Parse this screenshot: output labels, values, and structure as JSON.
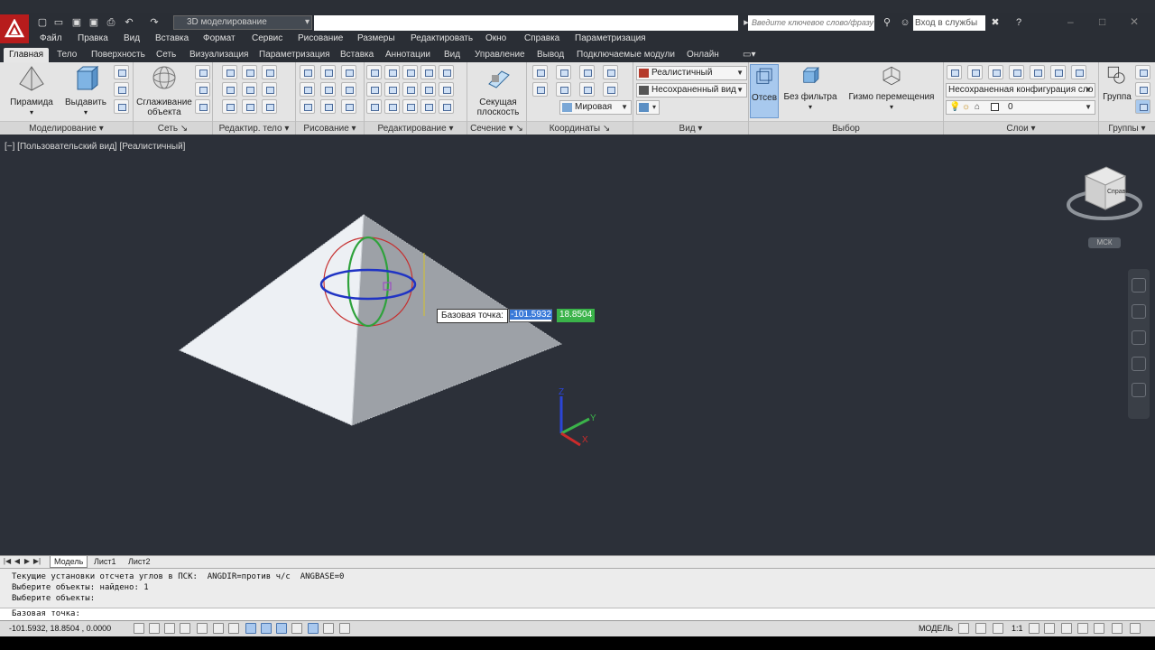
{
  "app": {
    "workspace": "3D моделирование",
    "search_placeholder": "Введите ключевое слово/фразу",
    "signin": "Вход в службы"
  },
  "menu": [
    "Файл",
    "Правка",
    "Вид",
    "Вставка",
    "Формат",
    "Сервис",
    "Рисование",
    "Размеры",
    "Редактировать",
    "Окно",
    "Справка",
    "Параметризация"
  ],
  "ribbon_tabs": [
    "Главная",
    "Тело",
    "Поверхность",
    "Сеть",
    "Визуализация",
    "Параметризация",
    "Вставка",
    "Аннотации",
    "Вид",
    "Управление",
    "Вывод",
    "Подключаемые модули",
    "Онлайн"
  ],
  "ribbon": {
    "pyramid": "Пирамида",
    "extrude": "Выдавить",
    "smooth_line1": "Сглаживание",
    "smooth_line2": "объекта",
    "section_line1": "Секущая",
    "section_line2": "плоскость",
    "visual_style": "Реалистичный",
    "saved_view": "Несохраненный вид",
    "ucs_world": "Мировая",
    "cull": "Отсев",
    "no_filter": "Без фильтра",
    "gizmo": "Гизмо перемещения",
    "layer_config": "Несохраненная конфигурация сло",
    "layer_current": "0",
    "group": "Группа",
    "panels": {
      "modeling": "Моделирование",
      "mesh": "Сеть",
      "solid_edit": "Редактир. тело",
      "draw": "Рисование",
      "modify": "Редактирование",
      "section": "Сечение",
      "coordinates": "Координаты",
      "view": "Вид",
      "selection": "Выбор",
      "layers": "Слои",
      "groups": "Группы"
    }
  },
  "viewport": {
    "label": "[−] [Пользовательский вид] [Реалистичный]",
    "dyn_prompt": "Базовая точка:",
    "dyn_x": "-101.5932",
    "dyn_y": "18.8504",
    "viewcube_label": "Справа",
    "ucs_badge": "МСК",
    "axis_x": "X",
    "axis_y": "Y",
    "axis_z": "Z"
  },
  "layout_tabs": [
    "Модель",
    "Лист1",
    "Лист2"
  ],
  "command": {
    "history": [
      "Текущие установки отсчета углов в ПСК:  ANGDIR=против ч/с  ANGBASE=0",
      "Выберите объекты: найдено: 1",
      "Выберите объекты:"
    ],
    "prompt": "Базовая точка:"
  },
  "status": {
    "coords": "-101.5932, 18.8504 , 0.0000",
    "model": "МОДЕЛЬ",
    "scale": "1:1"
  }
}
